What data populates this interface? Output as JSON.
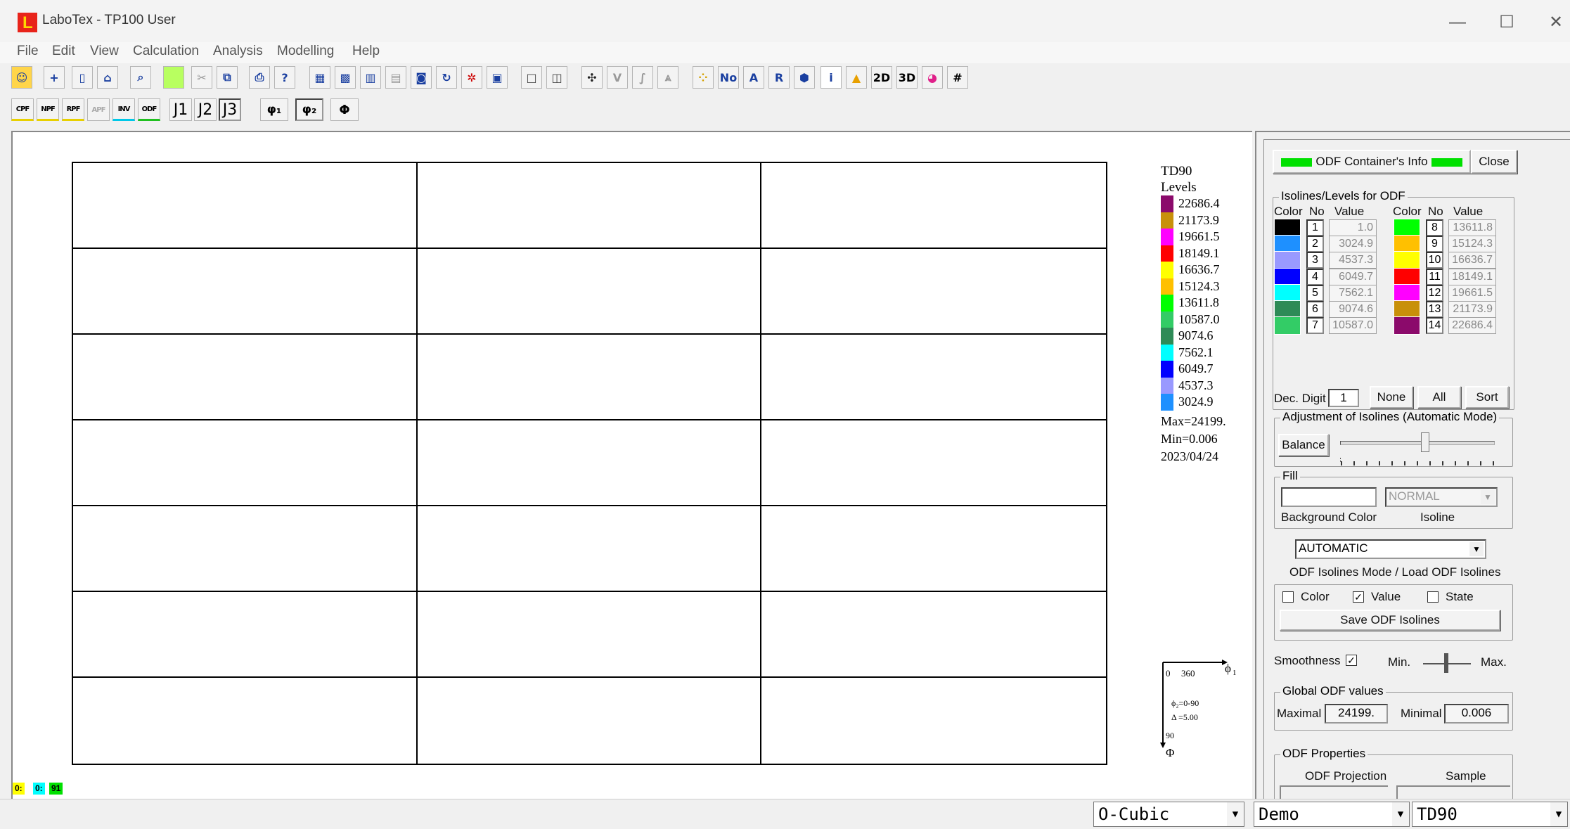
{
  "window": {
    "title": "LaboTex - TP100 User",
    "logo_letter": "L",
    "minimize": "—",
    "maximize": "☐",
    "close": "✕"
  },
  "menu": [
    "File",
    "Edit",
    "View",
    "Calculation",
    "Analysis",
    "Modelling",
    "Help"
  ],
  "toolbar2": {
    "cpf": "CPF",
    "npf": "NPF",
    "rpf": "RPF",
    "apf": "APF",
    "inv": "INV",
    "odf": "ODF",
    "j1": "J1",
    "j2": "J2",
    "j3": "J3",
    "phi1": "φ₁",
    "phi2": "φ₂",
    "phi": "Φ"
  },
  "toolbar1": {
    "no": "No",
    "a": "A",
    "r": "R",
    "i": "i",
    "twod": "2D",
    "threed": "3D",
    "grid": "#"
  },
  "legend": {
    "title": "TD90",
    "levels_label": "Levels",
    "levels": [
      {
        "value": "22686.4",
        "color": "#8b0a6b"
      },
      {
        "value": "21173.9",
        "color": "#c8900a"
      },
      {
        "value": "19661.5",
        "color": "#ff00ff"
      },
      {
        "value": "18149.1",
        "color": "#ff0000"
      },
      {
        "value": "16636.7",
        "color": "#ffff00"
      },
      {
        "value": "15124.3",
        "color": "#ffc000"
      },
      {
        "value": "13611.8",
        "color": "#00ff00"
      },
      {
        "value": "10587.0",
        "color": "#33cc66"
      },
      {
        "value": "9074.6",
        "color": "#2e8b57"
      },
      {
        "value": "7562.1",
        "color": "#00ffff"
      },
      {
        "value": "6049.7",
        "color": "#0000ff"
      },
      {
        "value": "4537.3",
        "color": "#9999ff"
      },
      {
        "value": "3024.9",
        "color": "#1e90ff"
      }
    ],
    "max": "Max=24199.",
    "min": "Min=0.006",
    "date": "2023/04/24"
  },
  "axes_glyph": {
    "zero": "0",
    "three60": "360",
    "phi1": "ϕ",
    "phi1_sub": "1",
    "phi2_range": "ϕ₂=0-90",
    "delta": "Δ =5.00",
    "ninety": "90",
    "phi": "Φ"
  },
  "bottom_tags": [
    "0:",
    "0:",
    "91"
  ],
  "panel": {
    "header": "ODF Container's Info",
    "close_btn": "Close",
    "isolines_group": "Isolines/Levels for ODF",
    "col_color": "Color",
    "col_no": "No",
    "col_value": "Value",
    "rows_left": [
      {
        "no": "1",
        "value": "1.0",
        "color": "#000000"
      },
      {
        "no": "2",
        "value": "3024.9",
        "color": "#1e90ff"
      },
      {
        "no": "3",
        "value": "4537.3",
        "color": "#9999ff"
      },
      {
        "no": "4",
        "value": "6049.7",
        "color": "#0000ff"
      },
      {
        "no": "5",
        "value": "7562.1",
        "color": "#00ffff"
      },
      {
        "no": "6",
        "value": "9074.6",
        "color": "#2e8b57"
      },
      {
        "no": "7",
        "value": "10587.0",
        "color": "#33cc66"
      }
    ],
    "rows_right": [
      {
        "no": "8",
        "value": "13611.8",
        "color": "#00ff00"
      },
      {
        "no": "9",
        "value": "15124.3",
        "color": "#ffc000"
      },
      {
        "no": "10",
        "value": "16636.7",
        "color": "#ffff00"
      },
      {
        "no": "11",
        "value": "18149.1",
        "color": "#ff0000"
      },
      {
        "no": "12",
        "value": "19661.5",
        "color": "#ff00ff"
      },
      {
        "no": "13",
        "value": "21173.9",
        "color": "#c8900a"
      },
      {
        "no": "14",
        "value": "22686.4",
        "color": "#8b0a6b"
      }
    ],
    "dec_digit_label": "Dec. Digit",
    "dec_digit_value": "1",
    "none_btn": "None",
    "all_btn": "All",
    "sort_btn": "Sort",
    "adjust_group": "Adjustment of Isolines (Automatic Mode)",
    "balance_btn": "Balance",
    "adjust_level": 0.55,
    "fill_group": "Fill",
    "fill_value": "",
    "fill_mode": "NORMAL",
    "bg_color_label": "Background Color",
    "isoline_label": "Isoline",
    "mode_value": "AUTOMATIC",
    "mode_label": "ODF Isolines Mode / Load ODF Isolines",
    "chk_color_label": "Color",
    "chk_value_label": "Value",
    "chk_state_label": "State",
    "save_btn": "Save ODF Isolines",
    "smoothness_label": "Smoothness",
    "min_label": "Min.",
    "max_label": "Max.",
    "global_group": "Global ODF values",
    "maximal_label": "Maximal",
    "maximal_value": "24199.",
    "minimal_label": "Minimal",
    "minimal_value": "0.006",
    "props_group": "ODF Properties",
    "projection_label": "ODF Projection",
    "sample_label": "Sample"
  },
  "status": {
    "symmetry": "O-Cubic",
    "project": "Demo",
    "odf": "TD90",
    "arrow": "▼"
  }
}
